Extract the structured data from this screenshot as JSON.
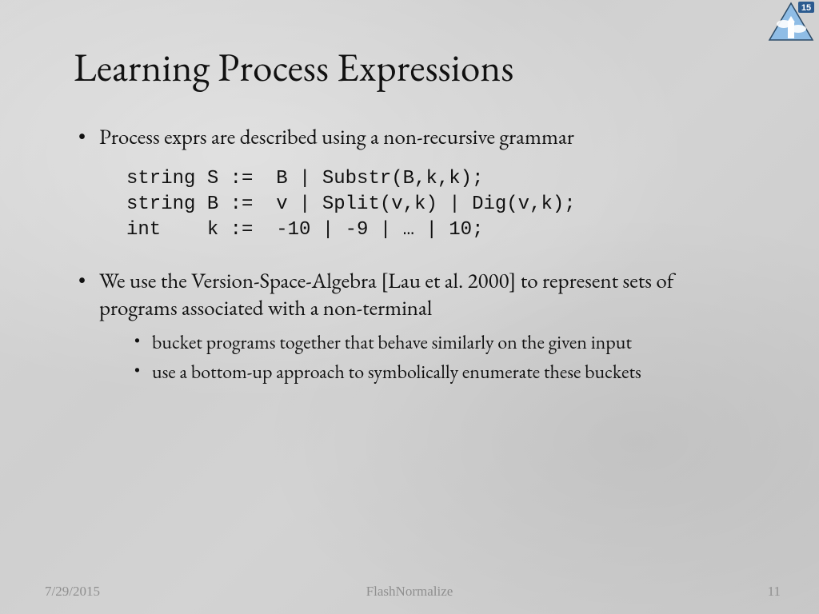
{
  "title": "Learning Process Expressions",
  "bullets": [
    {
      "text": "Process exprs are described using a non-recursive grammar",
      "code": "string S :=  B | Substr(B,k,k);\nstring B :=  v | Split(v,k) | Dig(v,k);\nint    k :=  -10 | -9 | … | 10;"
    },
    {
      "text": "We use the Version-Space-Algebra [Lau et al. 2000] to represent sets of programs associated with a non-terminal",
      "sub": [
        "bucket programs together that behave similarly on the given input",
        "use a bottom-up approach to symbolically enumerate these buckets"
      ]
    }
  ],
  "footer": {
    "date": "7/29/2015",
    "label": "FlashNormalize",
    "page": "11"
  },
  "logo": {
    "badge_text": "15"
  }
}
